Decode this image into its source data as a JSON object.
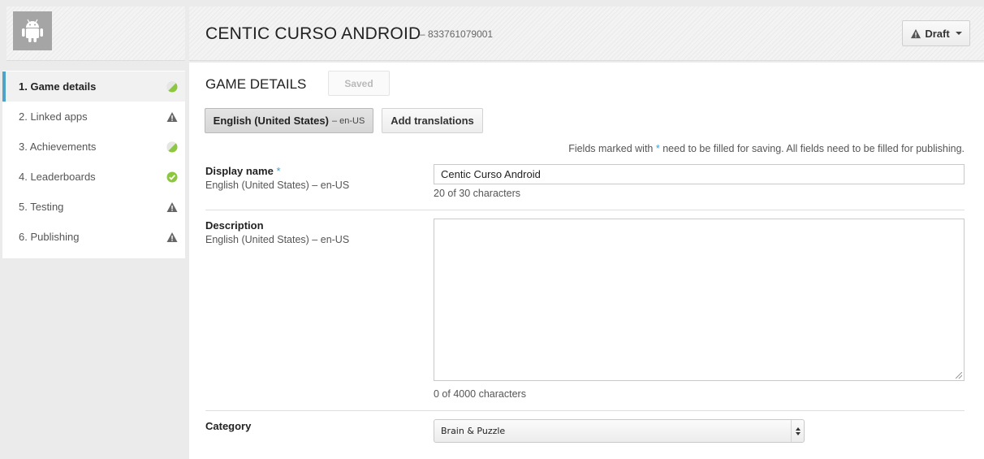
{
  "app": {
    "title": "CENTIC CURSO ANDROID",
    "id_text": "– 833761079001",
    "icon": "android-icon"
  },
  "header": {
    "status_button": {
      "label": "Draft",
      "icon": "warning-icon"
    }
  },
  "sidebar": {
    "items": [
      {
        "label": "1. Game details",
        "status": "partial",
        "active": true
      },
      {
        "label": "2. Linked apps",
        "status": "warning"
      },
      {
        "label": "3. Achievements",
        "status": "partial"
      },
      {
        "label": "4. Leaderboards",
        "status": "complete"
      },
      {
        "label": "5. Testing",
        "status": "warning"
      },
      {
        "label": "6. Publishing",
        "status": "warning"
      }
    ]
  },
  "main": {
    "title": "GAME DETAILS",
    "saved_label": "Saved",
    "language_tab": {
      "name": "English (United States)",
      "code": "– en-US"
    },
    "add_translations_label": "Add translations",
    "fields_note_pre": "Fields marked with",
    "fields_note_star": "*",
    "fields_note_post": "need to be filled for saving. All fields need to be filled for publishing.",
    "display_name": {
      "label": "Display name",
      "required_mark": "*",
      "sub": "English (United States) – en-US",
      "value": "Centic Curso Android",
      "count": "20 of 30 characters"
    },
    "description": {
      "label": "Description",
      "sub": "English (United States) – en-US",
      "value": "",
      "count": "0 of 4000 characters"
    },
    "category": {
      "label": "Category",
      "selected": "Brain & Puzzle"
    }
  },
  "colors": {
    "accent": "#4fa3c7",
    "status_green": "#8dc63f",
    "warning_gray": "#666666",
    "required_star": "#3a9fd1"
  }
}
